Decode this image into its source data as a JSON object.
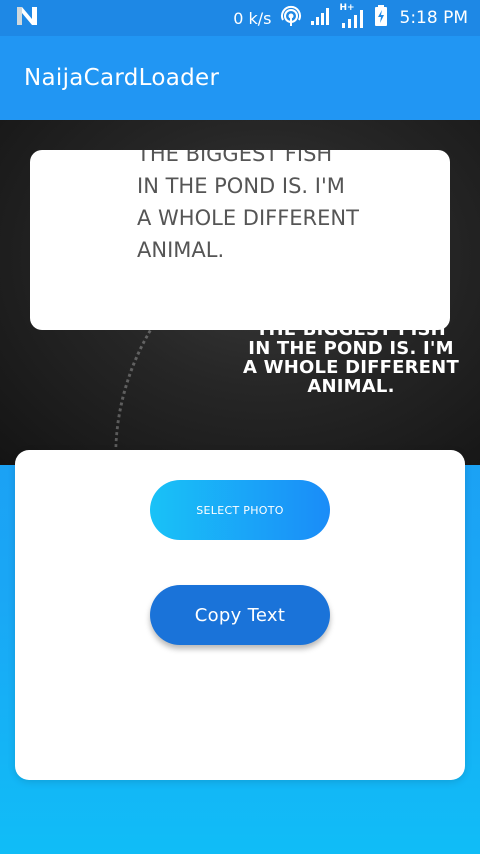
{
  "status_bar": {
    "net_speed": "0 k/s",
    "network_type": "H+",
    "time": "5:18 PM",
    "icons": [
      "n-logo-icon",
      "hotspot-icon",
      "signal-icon",
      "signal-hplus-icon",
      "battery-icon"
    ]
  },
  "app_bar": {
    "title": "NaijaCardLoader",
    "color": "#2196f3"
  },
  "photo": {
    "quote": "THE BIGGEST FISH\nIN THE POND IS. I'M\nA WHOLE DIFFERENT\nANIMAL."
  },
  "card": {
    "text": "THE BIGGEST FISH\nIN THE POND IS. I'M\n A WHOLE DIFFERENT\nANIMAL."
  },
  "buttons": {
    "select_photo": "SELECT PHOTO",
    "copy_text": "Copy Text"
  },
  "colors": {
    "status_bar": "#1e88e5",
    "accent": "#1a73d9",
    "gradient_start": "#19c2f7",
    "gradient_end": "#1a8cf8"
  }
}
